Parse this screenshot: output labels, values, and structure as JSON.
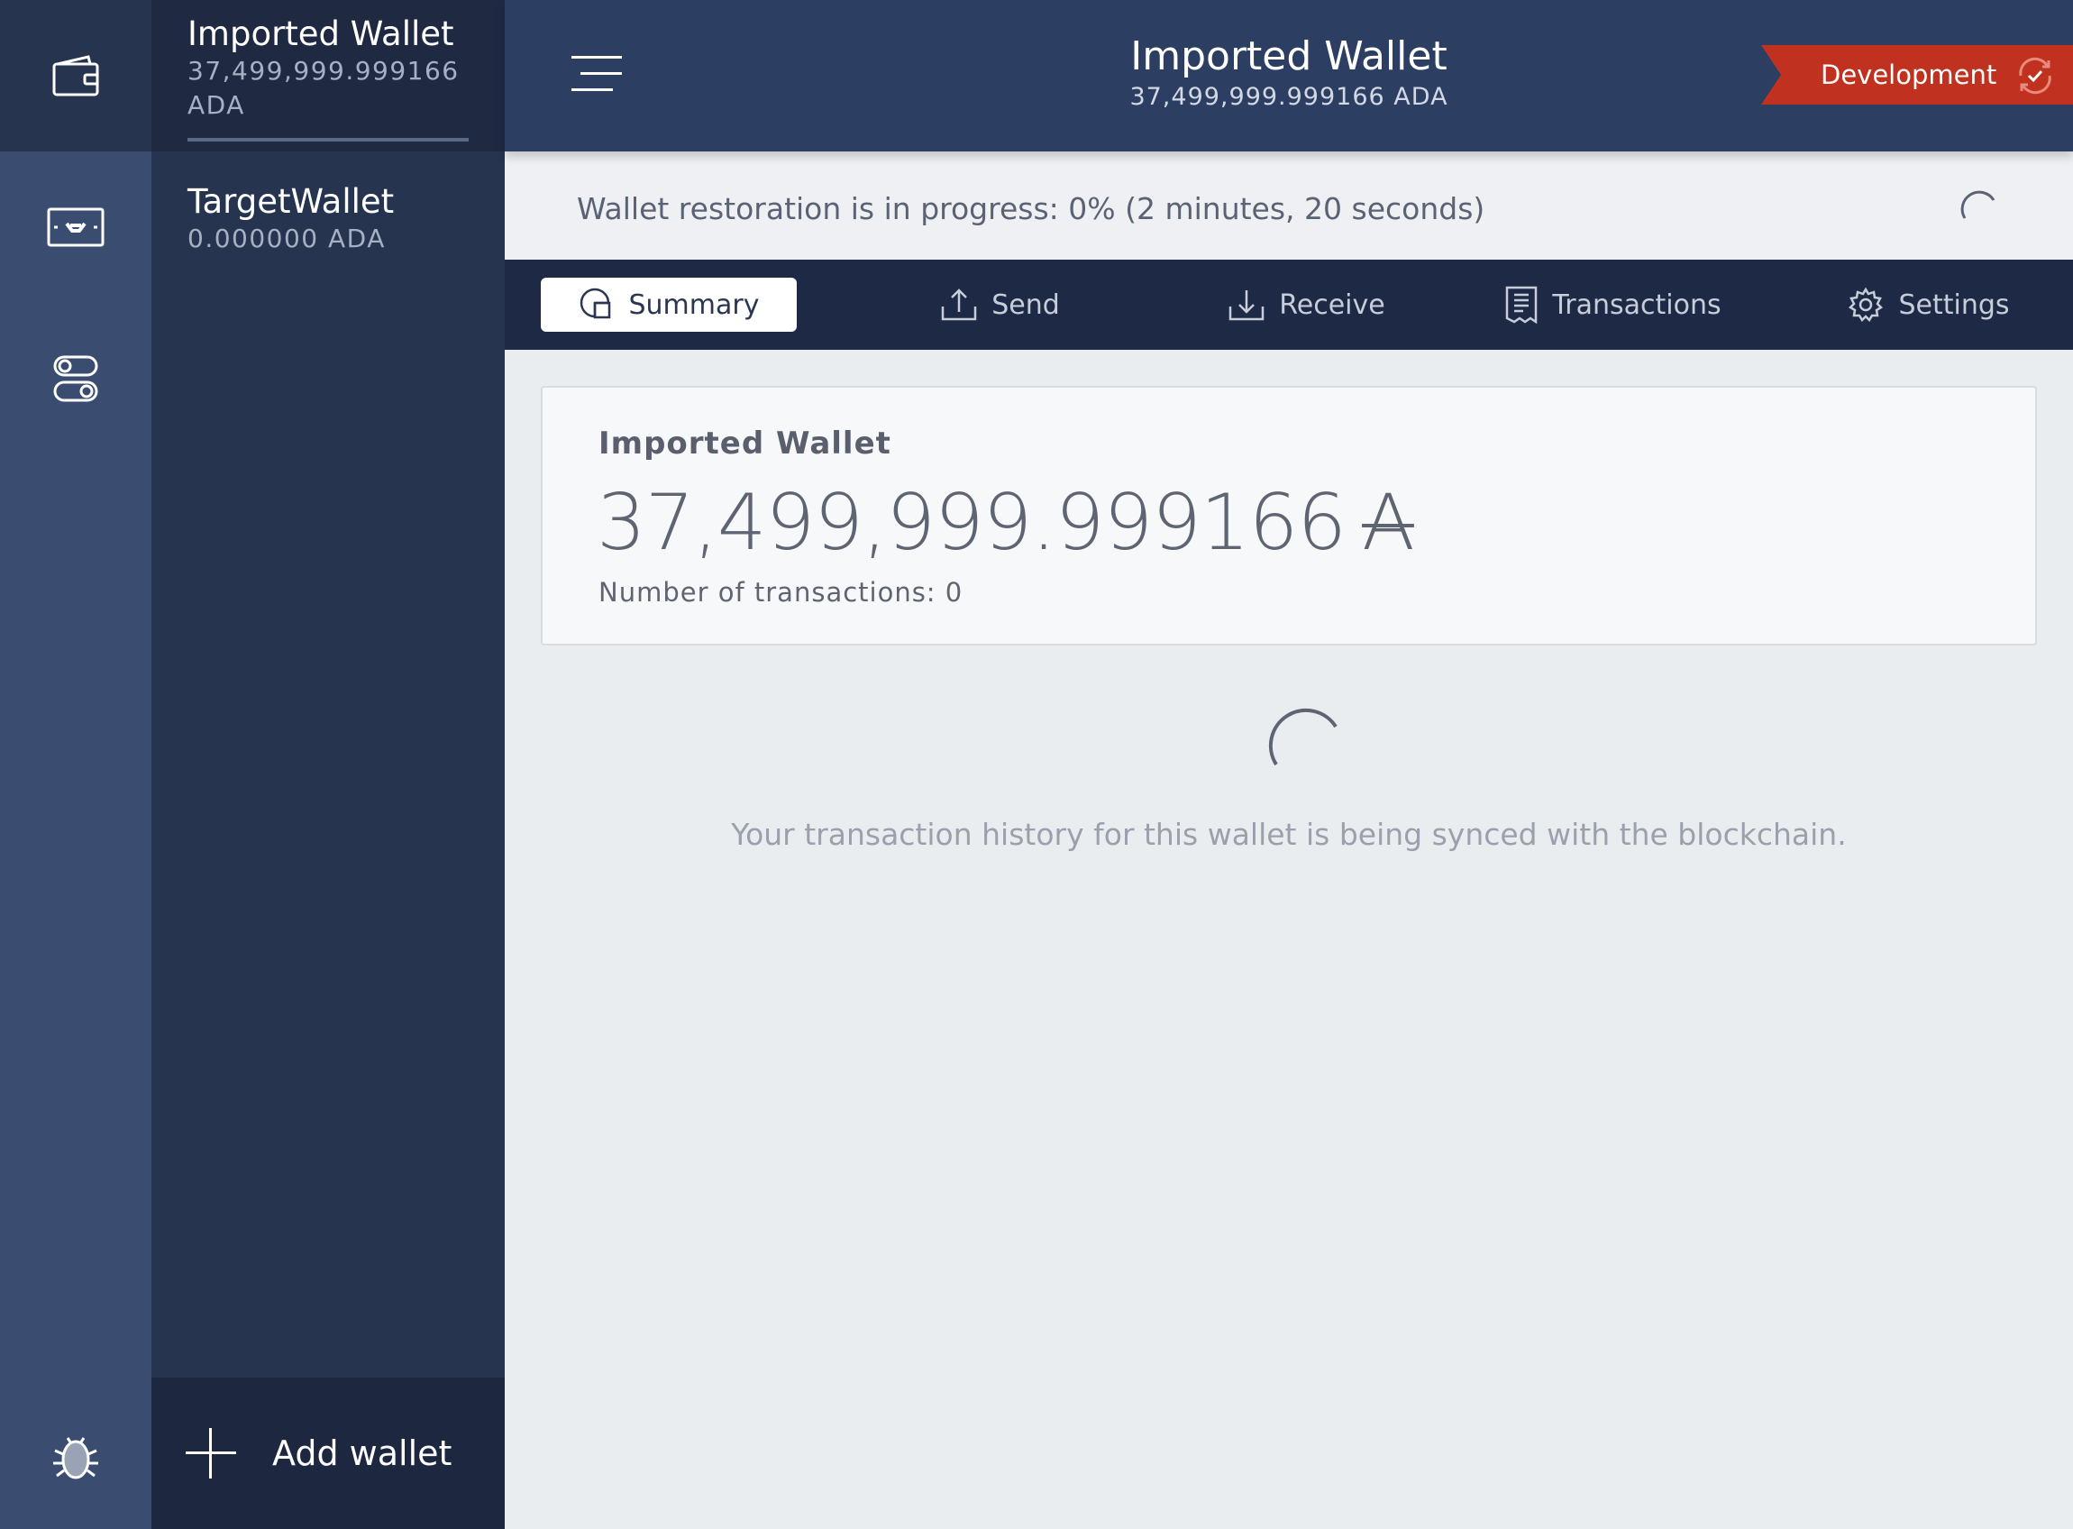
{
  "app": {
    "rail": {
      "items": [
        {
          "icon": "wallet-icon"
        },
        {
          "icon": "ada-redemption-icon"
        },
        {
          "icon": "settings-toggle-icon"
        },
        {
          "icon": "bug-icon"
        }
      ]
    },
    "wallets": [
      {
        "name": "Imported Wallet",
        "balance": "37,499,999.999166 ADA",
        "active": true
      },
      {
        "name": "TargetWallet",
        "balance": "0.000000 ADA",
        "active": false
      }
    ],
    "add_wallet_label": "Add wallet"
  },
  "topbar": {
    "title": "Imported Wallet",
    "subtitle": "37,499,999.999166 ADA",
    "badge_label": "Development"
  },
  "restoration": {
    "text": "Wallet restoration is in progress: 0% (2 minutes, 20 seconds)"
  },
  "tabs": [
    {
      "label": "Summary",
      "icon": "summary-icon",
      "active": true
    },
    {
      "label": "Send",
      "icon": "send-icon",
      "active": false
    },
    {
      "label": "Receive",
      "icon": "receive-icon",
      "active": false
    },
    {
      "label": "Transactions",
      "icon": "transactions-icon",
      "active": false
    },
    {
      "label": "Settings",
      "icon": "gear-icon",
      "active": false
    }
  ],
  "summary": {
    "wallet_name": "Imported Wallet",
    "amount": "37,499,999.999166",
    "currency_symbol": "A",
    "tx_count_text": "Number of transactions: 0"
  },
  "sync_message": "Your transaction history for this wallet is being synced with the blockchain.",
  "colors": {
    "rail": "#3a4c70",
    "panel": "#263450",
    "topbar": "#2c3e62",
    "tabbar": "#1e2a45",
    "badge": "#c0311f",
    "content_bg": "#eaedf0"
  }
}
